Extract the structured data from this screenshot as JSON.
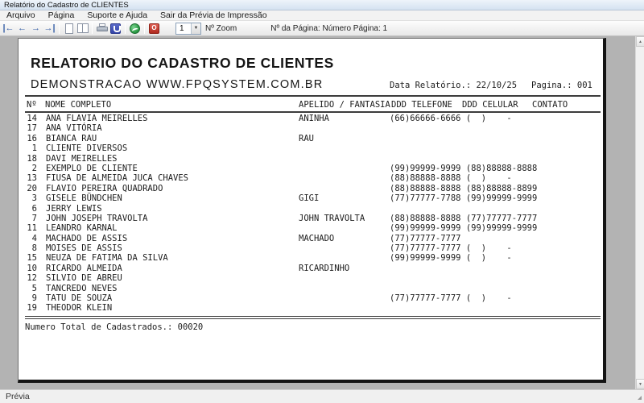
{
  "window": {
    "title": "Relatório do Cadastro de CLIENTES"
  },
  "menu": {
    "items": [
      "Arquivo",
      "Página",
      "Suporte e Ajuda",
      "Sair da Prévia de Impressão"
    ]
  },
  "toolbar": {
    "zoom_value": "1",
    "zoom_label": "Nº Zoom",
    "page_info": "Nº da Página: Número Página: 1"
  },
  "icons": {
    "first": "|←",
    "prev": "←",
    "next": "→",
    "last": "→|",
    "dropdown": "▼",
    "up": "▲",
    "down": "▼",
    "exit_glyph": "O"
  },
  "report": {
    "title": "RELATORIO DO CADASTRO DE CLIENTES",
    "subtitle": "DEMONSTRACAO WWW.FPQSYSTEM.COM.BR",
    "date_label": "Data Relatório.: 22/10/25",
    "page_label": "Pagina.: 001",
    "columns": [
      "Nº",
      "NOME COMPLETO",
      "APELIDO / FANTASIA",
      "DDD TELEFONE",
      "DDD CELULAR",
      "CONTATO"
    ],
    "rows": [
      {
        "num": 14,
        "nome": "ANA FLAVIA MEIRELLES",
        "apelido": "ANINHA",
        "telefone": "(66)66666-6666",
        "celular": "(  )",
        "contato": "-"
      },
      {
        "num": 17,
        "nome": "ANA VITÓRIA",
        "apelido": "",
        "telefone": "",
        "celular": "",
        "contato": ""
      },
      {
        "num": 16,
        "nome": "BIANCA RAU",
        "apelido": "RAU",
        "telefone": "",
        "celular": "",
        "contato": ""
      },
      {
        "num": 1,
        "nome": "CLIENTE DIVERSOS",
        "apelido": "",
        "telefone": "",
        "celular": "",
        "contato": ""
      },
      {
        "num": 18,
        "nome": "DAVI MEIRELLES",
        "apelido": "",
        "telefone": "",
        "celular": "",
        "contato": ""
      },
      {
        "num": 2,
        "nome": "EXEMPLO DE CLIENTE",
        "apelido": "",
        "telefone": "(99)99999-9999",
        "celular": "(88)88888-8888",
        "contato": ""
      },
      {
        "num": 13,
        "nome": "FIUSA DE ALMEIDA JUCA CHAVES",
        "apelido": "",
        "telefone": "(88)88888-8888",
        "celular": "(  )",
        "contato": "-"
      },
      {
        "num": 20,
        "nome": "FLAVIO PEREIRA QUADRADO",
        "apelido": "",
        "telefone": "(88)88888-8888",
        "celular": "(88)88888-8899",
        "contato": ""
      },
      {
        "num": 3,
        "nome": "GISELE BÜNDCHEN",
        "apelido": "GIGI",
        "telefone": "(77)77777-7788",
        "celular": "(99)99999-9999",
        "contato": ""
      },
      {
        "num": 6,
        "nome": "JERRY LEWIS",
        "apelido": "",
        "telefone": "",
        "celular": "",
        "contato": ""
      },
      {
        "num": 7,
        "nome": "JOHN JOSEPH TRAVOLTA",
        "apelido": "JOHN TRAVOLTA",
        "telefone": "(88)88888-8888",
        "celular": "(77)77777-7777",
        "contato": ""
      },
      {
        "num": 11,
        "nome": "LEANDRO KARNAL",
        "apelido": "",
        "telefone": "(99)99999-9999",
        "celular": "(99)99999-9999",
        "contato": ""
      },
      {
        "num": 4,
        "nome": "MACHADO DE ASSIS",
        "apelido": "MACHADO",
        "telefone": "(77)77777-7777",
        "celular": "",
        "contato": ""
      },
      {
        "num": 8,
        "nome": "MOISES DE ASSIS",
        "apelido": "",
        "telefone": "(77)77777-7777",
        "celular": "(  )",
        "contato": "-"
      },
      {
        "num": 15,
        "nome": "NEUZA DE FATIMA DA SILVA",
        "apelido": "",
        "telefone": "(99)99999-9999",
        "celular": "(  )",
        "contato": "-"
      },
      {
        "num": 10,
        "nome": "RICARDO ALMEIDA",
        "apelido": "RICARDINHO",
        "telefone": "",
        "celular": "",
        "contato": ""
      },
      {
        "num": 12,
        "nome": "SILVIO DE ABREU",
        "apelido": "",
        "telefone": "",
        "celular": "",
        "contato": ""
      },
      {
        "num": 5,
        "nome": "TANCREDO NEVES",
        "apelido": "",
        "telefone": "",
        "celular": "",
        "contato": ""
      },
      {
        "num": 9,
        "nome": "TATU DE SOUZA",
        "apelido": "",
        "telefone": "(77)77777-7777",
        "celular": "(  )",
        "contato": "-"
      },
      {
        "num": 19,
        "nome": "THEODOR KLEIN",
        "apelido": "",
        "telefone": "",
        "celular": "",
        "contato": ""
      }
    ],
    "footer": "Numero Total de Cadastrados.: 00020"
  },
  "statusbar": {
    "text": "Prévia"
  },
  "colors": {
    "workarea_bg": "#b3b3b3",
    "nav_arrow_blue": "#3a62a8",
    "setup_blue": "#3243a8",
    "globe_green": "#2f9e48",
    "exit_red": "#b02a1f",
    "titlebar_top": "#eef4fa",
    "titlebar_bottom": "#d4e2f1"
  }
}
